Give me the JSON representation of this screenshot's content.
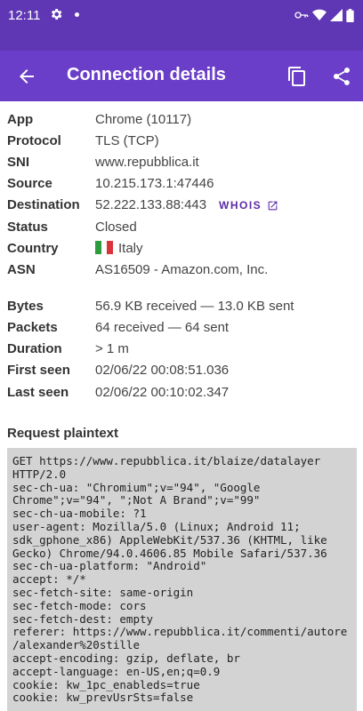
{
  "status_bar": {
    "time": "12:11"
  },
  "app_bar": {
    "title": "Connection details"
  },
  "details": [
    {
      "label": "App",
      "value": "Chrome (10117)"
    },
    {
      "label": "Protocol",
      "value": "TLS (TCP)"
    },
    {
      "label": "SNI",
      "value": "www.repubblica.it"
    },
    {
      "label": "Source",
      "value": "10.215.173.1:47446"
    },
    {
      "label": "Destination",
      "value": "52.222.133.88:443"
    },
    {
      "label": "Status",
      "value": "Closed"
    },
    {
      "label": "Country",
      "value": "Italy"
    },
    {
      "label": "ASN",
      "value": "AS16509 - Amazon.com, Inc."
    }
  ],
  "whois_label": "WHOIS",
  "stats": [
    {
      "label": "Bytes",
      "value": "56.9 KB received — 13.0 KB sent"
    },
    {
      "label": "Packets",
      "value": "64 received — 64 sent"
    },
    {
      "label": "Duration",
      "value": "> 1 m"
    },
    {
      "label": "First seen",
      "value": "02/06/22 00:08:51.036"
    },
    {
      "label": "Last seen",
      "value": "02/06/22 00:10:02.347"
    }
  ],
  "request_section": {
    "title": "Request plaintext",
    "lines": [
      "GET https://www.repubblica.it/blaize/datalayer",
      "HTTP/2.0",
      "sec-ch-ua: \"Chromium\";v=\"94\", \"Google",
      "Chrome\";v=\"94\", \";Not A Brand\";v=\"99\"",
      "sec-ch-ua-mobile: ?1",
      "user-agent: Mozilla/5.0 (Linux; Android 11;",
      "sdk_gphone_x86) AppleWebKit/537.36 (KHTML, like",
      "Gecko) Chrome/94.0.4606.85 Mobile Safari/537.36",
      "sec-ch-ua-platform: \"Android\"",
      "accept: */*",
      "sec-fetch-site: same-origin",
      "sec-fetch-mode: cors",
      "sec-fetch-dest: empty",
      "referer: https://www.repubblica.it/commenti/autore",
      "/alexander%20stille",
      "accept-encoding: gzip, deflate, br",
      "accept-language: en-US,en;q=0.9",
      "cookie: kw_1pc_enableds=true",
      "cookie: kw_prevUsrSts=false"
    ]
  },
  "colors": {
    "status_bar": "#5f37b4",
    "app_bar": "#6a3ec8",
    "whois_link": "#5b2ba7",
    "plaintext_bg": "#d3d3d3"
  }
}
